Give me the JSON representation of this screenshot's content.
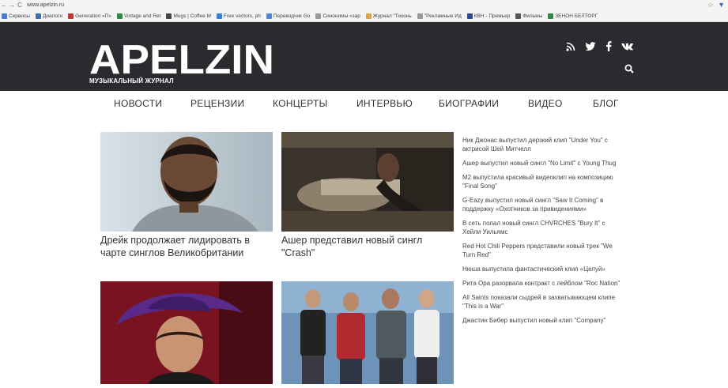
{
  "browser": {
    "url": "www.apelzin.ru",
    "bookmarks": [
      {
        "label": "Сервисы",
        "color": "#4a7bd0"
      },
      {
        "label": "Диалоги",
        "color": "#3b6fb8"
      },
      {
        "label": "Generation «П»",
        "color": "#b53b3b"
      },
      {
        "label": "Vintage and Ret",
        "color": "#2f8a4a"
      },
      {
        "label": "Mugs | Coffee M",
        "color": "#444444"
      },
      {
        "label": "Free vectors, ph",
        "color": "#3c7fd6"
      },
      {
        "label": "Переводчик Go",
        "color": "#4c86e4"
      },
      {
        "label": "Синонимы «зар",
        "color": "#999999"
      },
      {
        "label": "Журнал \"Тихонь",
        "color": "#e0a63a"
      },
      {
        "label": "\"Рекламные Ид",
        "color": "#999999"
      },
      {
        "label": "КВН - Премьер",
        "color": "#234d9c"
      },
      {
        "label": "Фильмы",
        "color": "#555555"
      },
      {
        "label": "ЗЕНОН БЕЛТОРГ",
        "color": "#2b8c3c"
      }
    ]
  },
  "header": {
    "logo_text": "APELZIN",
    "tagline": "МУЗЫКАЛЬНЫЙ ЖУРНАЛ",
    "bg_color": "#2a2b2f",
    "social_icons": [
      "rss-icon",
      "twitter-icon",
      "facebook-icon",
      "vk-icon"
    ]
  },
  "nav": {
    "items": [
      "НОВОСТИ",
      "РЕЦЕНЗИИ",
      "КОНЦЕРТЫ",
      "ИНТЕРВЬЮ",
      "БИОГРАФИИ",
      "ВИДЕО",
      "БЛОГ"
    ]
  },
  "articles": [
    {
      "title": "Дрейк продолжает лидировать в чарте синглов Великобритании"
    },
    {
      "title": "Ашер представил новый сингл \"Crash\""
    },
    {
      "title": ""
    },
    {
      "title": ""
    }
  ],
  "sidebar": {
    "news": [
      "Ник Джонас выпустил дерзкий клип \"Under You\" с актрисой Шей Митчелл",
      "Ашер выпустил новый сингл \"No Limit\" с Young Thug",
      "M2 выпустила красивый видеоклип на композицию \"Final Song\"",
      "G-Eazy выпустил новый сингл \"Saw It Coming\" в поддержку «Охотников за привидениями»",
      "В сеть попал новый сингл CHVRCHES \"Bury It\" с Хейли Уильямс",
      "Red Hot Chili Peppers представили новый трек \"We Turn Red\"",
      "Нюша выпустила фантастический клип «Целуй»",
      "Рита Ора разорвала контракт с лейблом \"Roc Nation\"",
      "All Saints показали сыдрей в захватывающем клипе \"This is a War\"",
      "Джастин Бибер выпустил новый клип \"Company\""
    ]
  }
}
